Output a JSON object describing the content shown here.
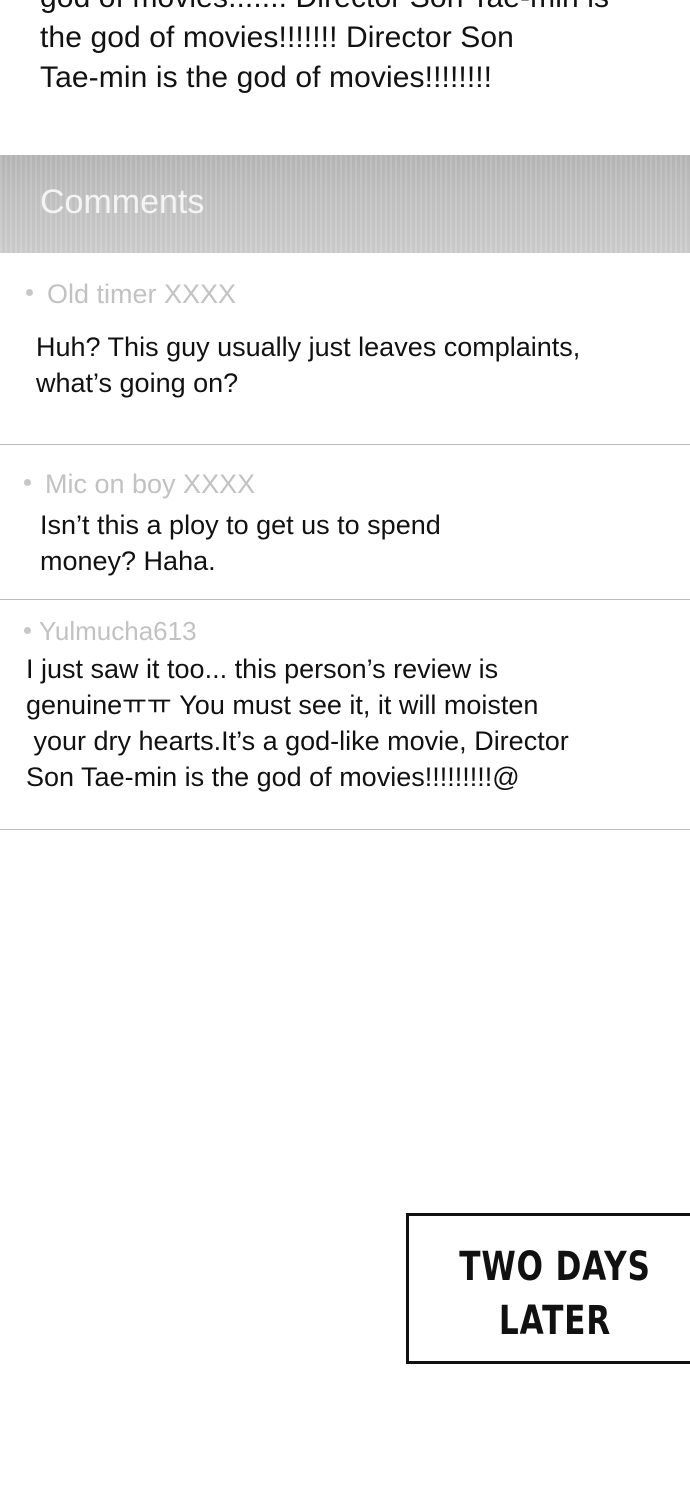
{
  "review": {
    "lines": [
      "god of movies....... Director Son Tae-min is",
      "the god of movies!!!!!!! Director Son",
      "Tae-min is the god of movies!!!!!!!!"
    ]
  },
  "comments_header": {
    "title": "Comments"
  },
  "comments": [
    {
      "author": "Old timer XXXX",
      "lines": [
        "Huh? This guy usually just leaves complaints,",
        "what’s going on?"
      ]
    },
    {
      "author": "Mic on boy XXXX",
      "lines": [
        "Isn’t this a ploy to get us to spend",
        "money? Haha."
      ]
    },
    {
      "author": "Yulmucha613",
      "lines": [
        "I just saw it too... this person’s review is",
        "genuineㅠㅠ You must see it, it will moisten",
        " your dry hearts.It’s a god-like movie, Director",
        "Son Tae-min is the god of movies!!!!!!!!!@"
      ]
    }
  ],
  "caption": {
    "lines": [
      "TWO DAYS",
      "LATER"
    ]
  }
}
